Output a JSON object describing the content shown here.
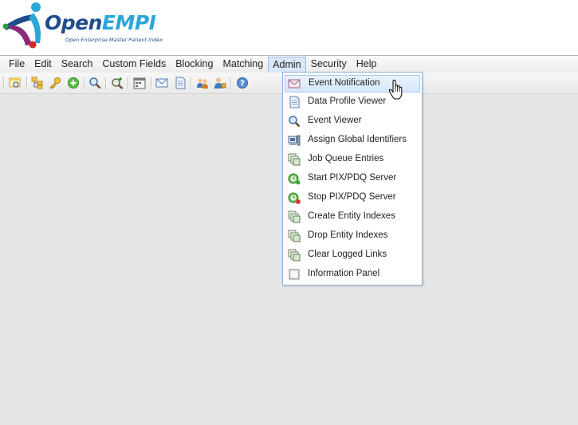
{
  "logo": {
    "brand_part1": "Open",
    "brand_part2": "EMPI",
    "tagline": "Open Enterprise Master Patient Index"
  },
  "menubar": {
    "items": [
      {
        "label": "File"
      },
      {
        "label": "Edit"
      },
      {
        "label": "Search"
      },
      {
        "label": "Custom Fields"
      },
      {
        "label": "Blocking"
      },
      {
        "label": "Matching"
      },
      {
        "label": "Admin"
      },
      {
        "label": "Security"
      },
      {
        "label": "Help"
      }
    ],
    "active": "Admin"
  },
  "toolbar": {
    "icons": [
      "search-window-icon",
      "tree-icon",
      "key-icon",
      "add-icon",
      "magnifier-icon",
      "magnifier-plus-icon",
      "calendar-icon",
      "mail-icon",
      "document-icon",
      "users-icon",
      "user-lock-icon",
      "help-icon"
    ]
  },
  "admin_menu": {
    "items": [
      {
        "label": "Event Notification",
        "icon": "mail-icon",
        "highlighted": true
      },
      {
        "label": "Data Profile Viewer",
        "icon": "document-icon"
      },
      {
        "label": "Event Viewer",
        "icon": "magnifier-icon"
      },
      {
        "label": "Assign Global Identifiers",
        "icon": "identifiers-icon"
      },
      {
        "label": "Job Queue Entries",
        "icon": "job-queue-icon"
      },
      {
        "label": "Start PIX/PDQ Server",
        "icon": "server-start-icon"
      },
      {
        "label": "Stop PIX/PDQ Server",
        "icon": "server-stop-icon"
      },
      {
        "label": "Create Entity Indexes",
        "icon": "index-create-icon"
      },
      {
        "label": "Drop Entity Indexes",
        "icon": "index-drop-icon"
      },
      {
        "label": "Clear Logged Links",
        "icon": "clear-links-icon"
      },
      {
        "label": "Information Panel",
        "icon": "checkbox-icon"
      }
    ]
  },
  "colors": {
    "menu_highlight": "#d4e7fa",
    "menu_border": "#8fb3d9",
    "background": "#e6e6e6",
    "brand_dark": "#1f4d8c",
    "brand_light": "#2aa7d8"
  }
}
